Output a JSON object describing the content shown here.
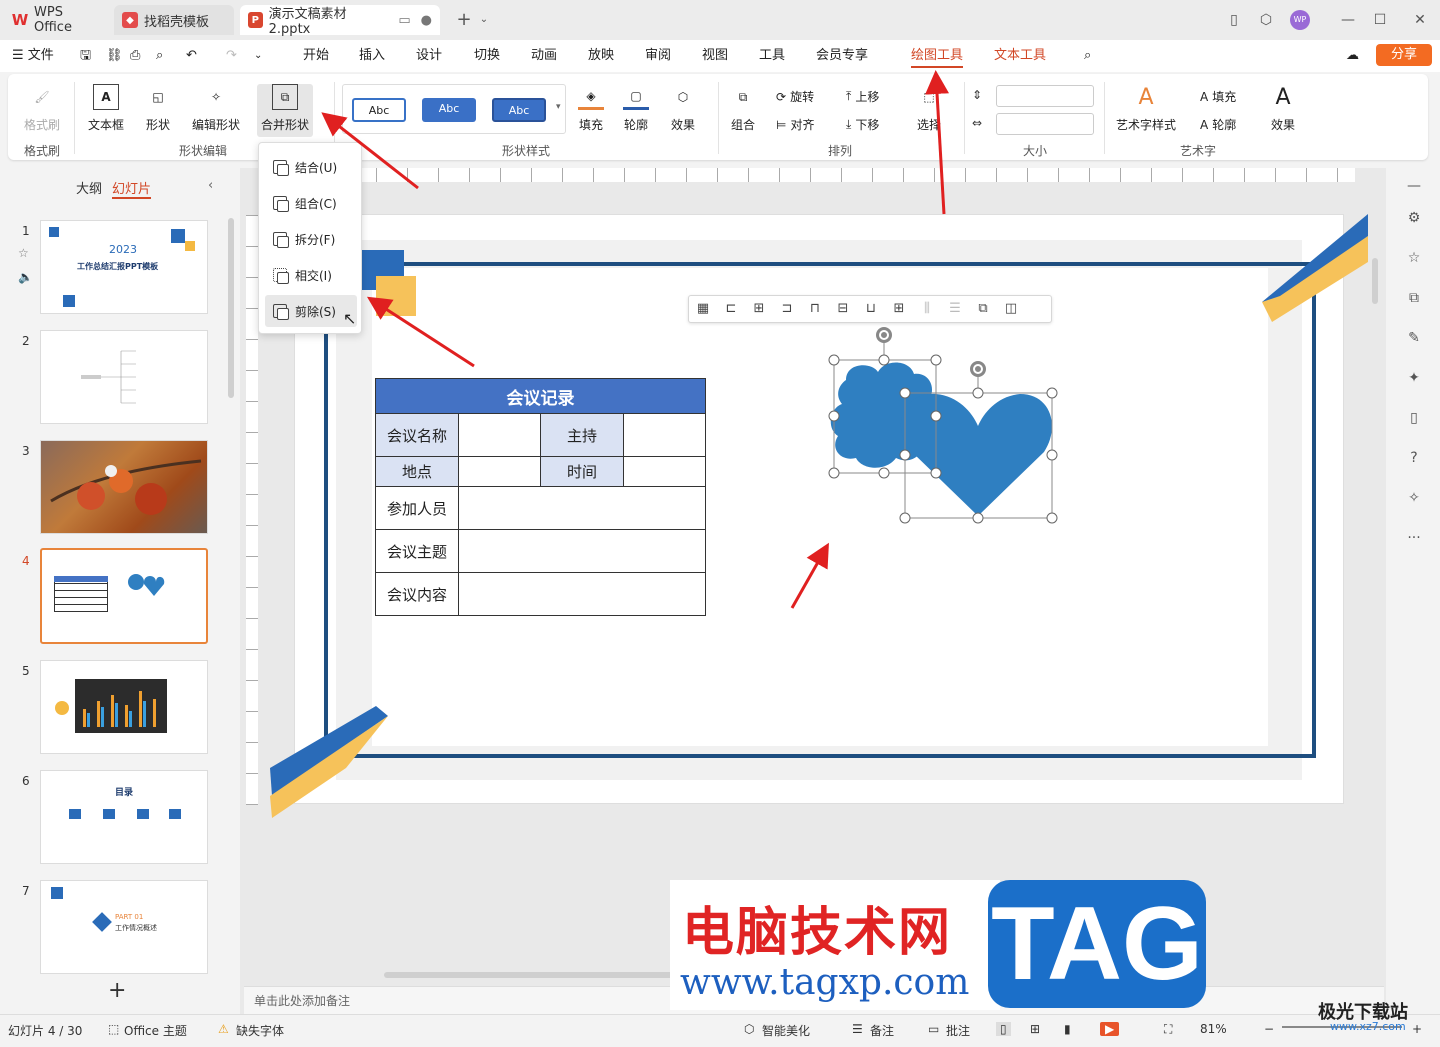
{
  "titlebar": {
    "tabs": [
      {
        "label": "WPS Office"
      },
      {
        "label": "找稻壳模板"
      },
      {
        "label": "演示文稿素材2.pptx"
      }
    ],
    "avatar": "WP"
  },
  "menu": {
    "file": "文件",
    "items": [
      "开始",
      "插入",
      "设计",
      "切换",
      "动画",
      "放映",
      "审阅",
      "视图",
      "工具",
      "会员专享"
    ],
    "drawing_tools": "绘图工具",
    "text_tools": "文本工具",
    "share": "分享"
  },
  "ribbon": {
    "format_brush": "格式刷",
    "format_brush_group": "格式刷",
    "textbox": "文本框",
    "shape": "形状",
    "edit_shape": "编辑形状",
    "merge_shape": "合并形状",
    "shape_edit_group": "形状编辑",
    "style_samples": [
      "Abc",
      "Abc",
      "Abc"
    ],
    "fill": "填充",
    "outline": "轮廓",
    "effect": "效果",
    "shape_style_group": "形状样式",
    "combine": "组合",
    "rotate": "旋转",
    "align": "对齐",
    "move_up": "上移",
    "move_down": "下移",
    "select": "选择",
    "arrange_group": "排列",
    "size_group": "大小",
    "art_style": "艺术字样式",
    "art_fill": "填充",
    "art_outline": "轮廓",
    "art_effect": "效果",
    "art_group": "艺术字"
  },
  "merge_menu": {
    "items": [
      {
        "label": "结合(U)",
        "icon": "union-icon"
      },
      {
        "label": "组合(C)",
        "icon": "combine-icon"
      },
      {
        "label": "拆分(F)",
        "icon": "fragment-icon"
      },
      {
        "label": "相交(I)",
        "icon": "intersect-icon"
      },
      {
        "label": "剪除(S)",
        "icon": "subtract-icon"
      }
    ]
  },
  "left_panel": {
    "tab_outline": "大纲",
    "tab_slides": "幻灯片",
    "slide_numbers": [
      "1",
      "2",
      "3",
      "4",
      "5",
      "6",
      "7"
    ],
    "slide1_year": "2023",
    "slide1_title": "工作总结汇报PPT模板",
    "slide6_title": "目录",
    "slide7_part": "PART 01",
    "slide7_title": "工作情况概述",
    "add_slide": "+"
  },
  "table": {
    "title": "会议记录",
    "row1": [
      "会议名称",
      "",
      "主持",
      ""
    ],
    "row2": [
      "地点",
      "",
      "时间",
      ""
    ],
    "row3": [
      "参加人员",
      ""
    ],
    "row4": [
      "会议主题",
      ""
    ],
    "row5": [
      "会议内容",
      ""
    ]
  },
  "notes_placeholder": "单击此处添加备注",
  "status": {
    "slide_info": "幻灯片 4 / 30",
    "theme": "Office 主题",
    "missing_font": "缺失字体",
    "smart_beautify": "智能美化",
    "notes": "备注",
    "comments": "批注",
    "zoom": "81%"
  },
  "watermark": {
    "cn": "电脑技术网",
    "url": "www.tagxp.com",
    "tag": "TAG",
    "jg": "极光下载站",
    "jg_url": "www.xz7.com"
  },
  "colors": {
    "accent": "#d24726",
    "table_header": "#4472c4",
    "table_label": "#dae2f3",
    "shape_blue": "#2f7fc1",
    "frame": "#1e4e80",
    "arrow": "#e02020"
  }
}
